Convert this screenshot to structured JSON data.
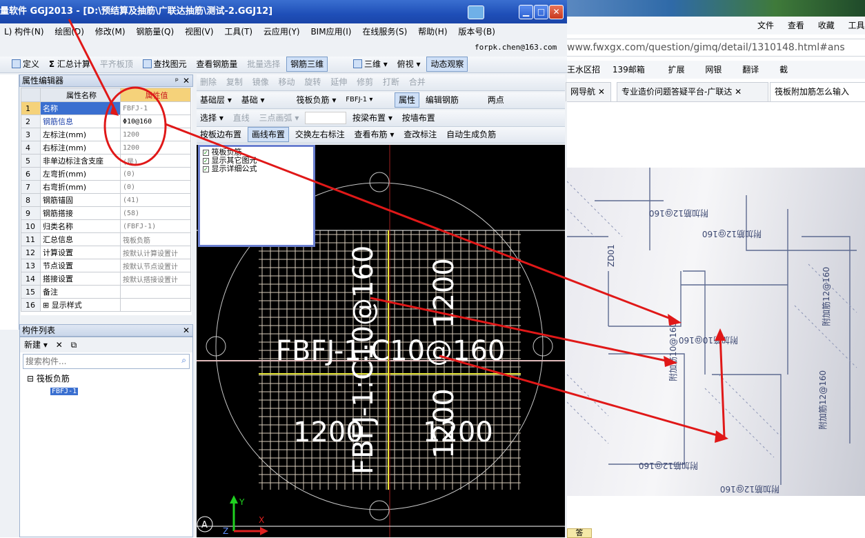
{
  "title": {
    "text": "量软件 GGJ2013 - [D:\\预结算及抽筋\\广联达抽筋\\测试-2.GGJ12]"
  },
  "menu": [
    "L) 构件(N)",
    "绘图(D)",
    "修改(M)",
    "钢筋量(Q)",
    "视图(V)",
    "工具(T)",
    "云应用(Y)",
    "BIM应用(I)",
    "在线服务(S)",
    "帮助(H)",
    "版本号(B)"
  ],
  "user": {
    "email": "forpk.chen@163.com"
  },
  "toolbar1": {
    "define": "定义",
    "sum": "汇总计算",
    "flat": "平齐板顶",
    "find": "查找图元",
    "view_rebar": "查看钢筋量",
    "batch": "批量选择",
    "rebar3d": "钢筋三维",
    "three_d": "三维",
    "top_view": "俯视",
    "dynamic": "动态观察"
  },
  "toolbar2": {
    "delete": "删除",
    "copy": "复制",
    "mirror": "镜像",
    "move": "移动",
    "rotate": "旋转",
    "extend": "延伸",
    "trim": "修剪",
    "break": "打断",
    "merge": "合并"
  },
  "toolbar3": {
    "layer": "基础层",
    "layer2": "基础",
    "type": "筏板负筋",
    "item": "FBFJ-1",
    "props": "属性",
    "edit_rebar": "编辑钢筋",
    "two_points": "两点"
  },
  "toolbar4": {
    "select": "选择",
    "line": "直线",
    "arc": "三点画弧",
    "beam_place": "按梁布置",
    "wall_place": "按墙布置"
  },
  "toolbar5": {
    "edge_place": "按板边布置",
    "line_place": "画线布置",
    "swap": "交换左右标注",
    "view_layout": "查看布筋",
    "check_label": "查改标注",
    "auto_gen": "自动生成负筋"
  },
  "props_panel": {
    "title": "属性编辑器",
    "col_name": "属性名称",
    "col_value": "属性值",
    "rows": [
      {
        "n": "1",
        "k": "名称",
        "v": "FBFJ-1"
      },
      {
        "n": "2",
        "k": "钢筋信息",
        "v": "Φ10@160"
      },
      {
        "n": "3",
        "k": "左标注(mm)",
        "v": "1200"
      },
      {
        "n": "4",
        "k": "右标注(mm)",
        "v": "1200"
      },
      {
        "n": "5",
        "k": "非单边标注含支座",
        "v": "(是)"
      },
      {
        "n": "6",
        "k": "左弯折(mm)",
        "v": "(0)"
      },
      {
        "n": "7",
        "k": "右弯折(mm)",
        "v": "(0)"
      },
      {
        "n": "8",
        "k": "钢筋锚固",
        "v": "(41)"
      },
      {
        "n": "9",
        "k": "钢筋搭接",
        "v": "(58)"
      },
      {
        "n": "10",
        "k": "归类名称",
        "v": "(FBFJ-1)"
      },
      {
        "n": "11",
        "k": "汇总信息",
        "v": "筏板负筋"
      },
      {
        "n": "12",
        "k": "计算设置",
        "v": "按默认计算设置计"
      },
      {
        "n": "13",
        "k": "节点设置",
        "v": "按默认节点设置计"
      },
      {
        "n": "14",
        "k": "搭接设置",
        "v": "按默认搭接设置计"
      },
      {
        "n": "15",
        "k": "备注",
        "v": ""
      },
      {
        "n": "16",
        "k": "显示样式",
        "v": ""
      }
    ]
  },
  "list_panel": {
    "title": "构件列表",
    "new": "新建",
    "search_placeholder": "搜索构件...",
    "group": "筏板负筋",
    "item": "FBFJ-1"
  },
  "checks": [
    "筏板负筋",
    "显示其它图元",
    "显示详细公式"
  ],
  "canvas": {
    "label_main": "FBFJ-1:C10@160",
    "label_left": "1200",
    "label_right": "1200",
    "label_top": "1200",
    "label_vert": "FBFJ-1:C10@160",
    "label_vert2": "1200",
    "axis_y": "Y",
    "axis_x": "X",
    "axis_z": "Z",
    "corner": "A"
  },
  "browser": {
    "menu": [
      "文件",
      "查看",
      "收藏",
      "工具"
    ],
    "url": "www.fwxgx.com/question/gimq/detail/1310148.html#ans",
    "bookmarks": [
      "王水区招",
      "139邮箱",
      "扩展",
      "网银",
      "翻译",
      "截"
    ],
    "tabs": [
      "网导航",
      "专业造价问题答疑平台-广联达",
      "筏板附加筋怎么输入"
    ],
    "photo_texts": [
      "附加筋12@160",
      "附加筋12@160",
      "ZD01",
      "附加筋10@160",
      "附加筋10@160",
      "附加筋12@160",
      "附加筋12@160",
      "附加筋12@160",
      "附加筋12@160"
    ],
    "bottom_btn": "答"
  }
}
